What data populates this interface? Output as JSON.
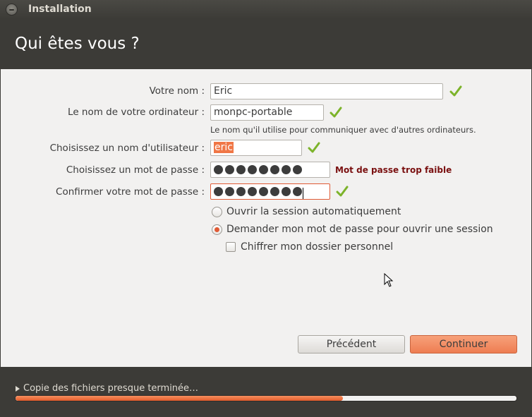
{
  "window": {
    "title": "Installation"
  },
  "header": {
    "title": "Qui êtes vous ?"
  },
  "form": {
    "name": {
      "label": "Votre nom :",
      "value": "Eric"
    },
    "computer": {
      "label": "Le nom de votre ordinateur :",
      "value": "monpc-portable",
      "hint": "Le nom qu'il utilise pour communiquer avec d'autres ordinateurs."
    },
    "username": {
      "label": "Choisissez un nom d'utilisateur :",
      "value": "eric"
    },
    "password": {
      "label": "Choisissez un mot de passe :",
      "strength": "Mot de passe trop faible",
      "dot_count": 8
    },
    "confirm": {
      "label": "Confirmer votre mot de passe :",
      "dot_count": 8
    },
    "login_options": {
      "auto": "Ouvrir la session automatiquement",
      "ask": "Demander mon mot de passe pour ouvrir une session",
      "selected": "ask"
    },
    "encrypt": {
      "label": "Chiffrer mon dossier personnel",
      "checked": false
    }
  },
  "buttons": {
    "back": "Précédent",
    "continue": "Continuer"
  },
  "progress": {
    "label": "Copie des fichiers presque terminée…",
    "fraction": 0.653
  },
  "colors": {
    "accent": "#e05a35",
    "check": "#7cb32a",
    "warning": "#7a1010"
  },
  "icons": [
    "close-icon",
    "check-icon",
    "triangle-right-icon",
    "mouse-cursor-icon"
  ]
}
